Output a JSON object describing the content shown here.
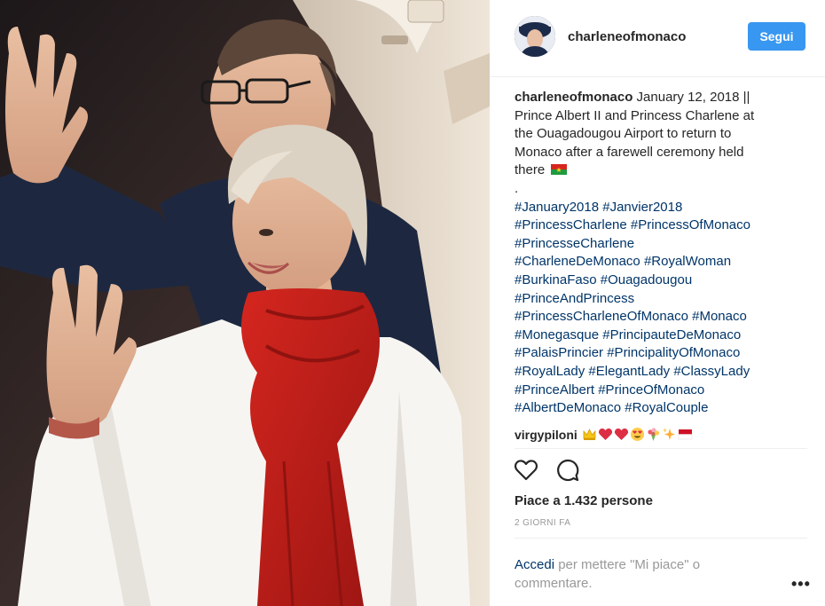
{
  "post": {
    "username": "charleneofmonaco",
    "follow_label": "Segui",
    "caption_lines": [
      "January 12, 2018 ||",
      "Prince Albert II and Princess Charlene at",
      "the Ouagadougou Airport to return to",
      "Monaco after a farewell ceremony held",
      "there"
    ],
    "caption_dot": ".",
    "hashtag_lines": [
      [
        "#January2018",
        "#Janvier2018"
      ],
      [
        "#PrincessCharlene",
        "#PrincessOfMonaco"
      ],
      [
        "#PrincesseCharlene"
      ],
      [
        "#CharleneDeMonaco",
        "#RoyalWoman"
      ],
      [
        "#BurkinaFaso",
        "#Ouagadougou"
      ],
      [
        "#PrinceAndPrincess"
      ],
      [
        "#PrincessCharleneOfMonaco",
        "#Monaco"
      ],
      [
        "#Monegasque",
        "#PrincipauteDeMonaco"
      ],
      [
        "#PalaisPrincier",
        "#PrincipalityOfMonaco"
      ],
      [
        "#RoyalLady",
        "#ElegantLady",
        "#ClassyLady"
      ],
      [
        "#PrinceAlbert",
        "#PrinceOfMonaco"
      ],
      [
        "#AlbertDeMonaco",
        "#RoyalCouple"
      ]
    ],
    "comment": {
      "username": "virgypiloni",
      "emojis": [
        "crown-emoji",
        "red-heart-emoji",
        "red-heart-emoji",
        "heart-eyes-emoji",
        "bouquet-emoji",
        "sparkles-emoji",
        "monaco-flag-emoji"
      ]
    },
    "likes_text": "Piace a 1.432 persone",
    "timestamp": "2 GIORNI FA",
    "login_link": "Accedi",
    "login_text": " per mettere \"Mi piace\" o commentare.",
    "more_label": "•••"
  },
  "colors": {
    "follow_button": "#3897f0",
    "hashtag": "#003569",
    "muted": "#999999",
    "scarf": "#c8201e"
  }
}
